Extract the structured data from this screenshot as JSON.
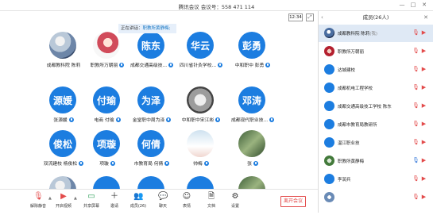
{
  "window": {
    "title": "腾讯会议 会议号：558 471 114",
    "min_glyph": "—",
    "max_glyph": "□",
    "close_glyph": "✕"
  },
  "top": {
    "clock": "12:34",
    "fullscreen_glyph": "⤢"
  },
  "speaking": {
    "prefix": "正在讲话：",
    "name": "职教所黄静梅;"
  },
  "grid": [
    {
      "avatar": "",
      "name": "成都教科院 陈莉",
      "kind": "photo",
      "mic": false
    },
    {
      "avatar": "",
      "name": "职教所万朝丽",
      "kind": "photo2",
      "mic": true
    },
    {
      "avatar": "陈东",
      "name": "成都交通高级技...",
      "kind": "text",
      "mic": true
    },
    {
      "avatar": "华云",
      "name": "四川省针灸学校...",
      "kind": "text",
      "mic": true
    },
    {
      "avatar": "彭勇",
      "name": "中和职中 彭勇",
      "kind": "text",
      "mic": true
    },
    {
      "avatar": "源媛",
      "name": "张源媛",
      "kind": "text",
      "mic": true
    },
    {
      "avatar": "付瑜",
      "name": "电商 付瑜",
      "kind": "text",
      "mic": true
    },
    {
      "avatar": "为泽",
      "name": "金堂职中周为泽",
      "kind": "text",
      "mic": true
    },
    {
      "avatar": "",
      "name": "中和职中宋江彬",
      "kind": "photo5",
      "mic": true
    },
    {
      "avatar": "邓涛",
      "name": "成都现代职业技...",
      "kind": "text",
      "mic": true
    },
    {
      "avatar": "俊松",
      "name": "双流建校 杨俊松",
      "kind": "text",
      "mic": true
    },
    {
      "avatar": "项璇",
      "name": "项璇",
      "kind": "text",
      "mic": true
    },
    {
      "avatar": "何倩",
      "name": "市教育局 何倩",
      "kind": "text",
      "mic": true
    },
    {
      "avatar": "",
      "name": "帅梅",
      "kind": "photo3",
      "mic": true
    },
    {
      "avatar": "",
      "name": "张",
      "kind": "photo4",
      "mic": true
    },
    {
      "avatar": "",
      "name": "",
      "kind": "photo",
      "mic": false
    },
    {
      "avatar": "",
      "name": "",
      "kind": "text",
      "mic": false
    },
    {
      "avatar": "",
      "name": "",
      "kind": "text",
      "mic": false
    },
    {
      "avatar": "",
      "name": "",
      "kind": "text",
      "mic": false
    },
    {
      "avatar": "",
      "name": "",
      "kind": "photo4",
      "mic": false
    }
  ],
  "toolbar": {
    "mute": {
      "label": "解除静音",
      "glyph": "🎙"
    },
    "video": {
      "label": "开启视频",
      "glyph": "▶"
    },
    "share": {
      "label": "共享屏幕",
      "glyph": "▭"
    },
    "invite": {
      "label": "邀请",
      "glyph": "＋"
    },
    "members": {
      "label": "成员(26)",
      "glyph": "👥"
    },
    "chat": {
      "label": "聊天",
      "glyph": "💬"
    },
    "emoji": {
      "label": "表情",
      "glyph": "☺"
    },
    "docs": {
      "label": "文档",
      "glyph": "🗎"
    },
    "settings": {
      "label": "设置",
      "glyph": "⚙"
    },
    "caret": "▲",
    "end": "离开会议"
  },
  "panel": {
    "title": "成员(26人)",
    "close": "✕",
    "collapse": "‹",
    "members": [
      {
        "name": "成都教科院 陈莉",
        "tag": "(我)",
        "av": "a1",
        "mic": "off",
        "cam": "off",
        "sel": true
      },
      {
        "name": "职教所万朝丽",
        "tag": "",
        "av": "a3",
        "mic": "off",
        "cam": "off",
        "sel": false
      },
      {
        "name": "达城建校",
        "tag": "",
        "av": "a2",
        "mic": "off",
        "cam": "off",
        "sel": false
      },
      {
        "name": "成都机电工程学校",
        "tag": "",
        "av": "a2",
        "mic": "off",
        "cam": "off",
        "sel": false
      },
      {
        "name": "成都交通高级技工学校 陈东",
        "tag": "",
        "av": "a2",
        "mic": "off",
        "cam": "off",
        "sel": false
      },
      {
        "name": "成都市教育局教研所",
        "tag": "",
        "av": "a2",
        "mic": "off",
        "cam": "off",
        "sel": false
      },
      {
        "name": "温江职业技",
        "tag": "",
        "av": "a2",
        "mic": "off",
        "cam": "off",
        "sel": false
      },
      {
        "name": "职教所黄静梅",
        "tag": "",
        "av": "a4",
        "mic": "on",
        "cam": "off",
        "sel": false
      },
      {
        "name": "李润兵",
        "tag": "",
        "av": "a2",
        "mic": "off",
        "cam": "off",
        "sel": false
      },
      {
        "name": "",
        "tag": "",
        "av": "a5",
        "mic": "off",
        "cam": "off",
        "sel": false
      }
    ]
  }
}
